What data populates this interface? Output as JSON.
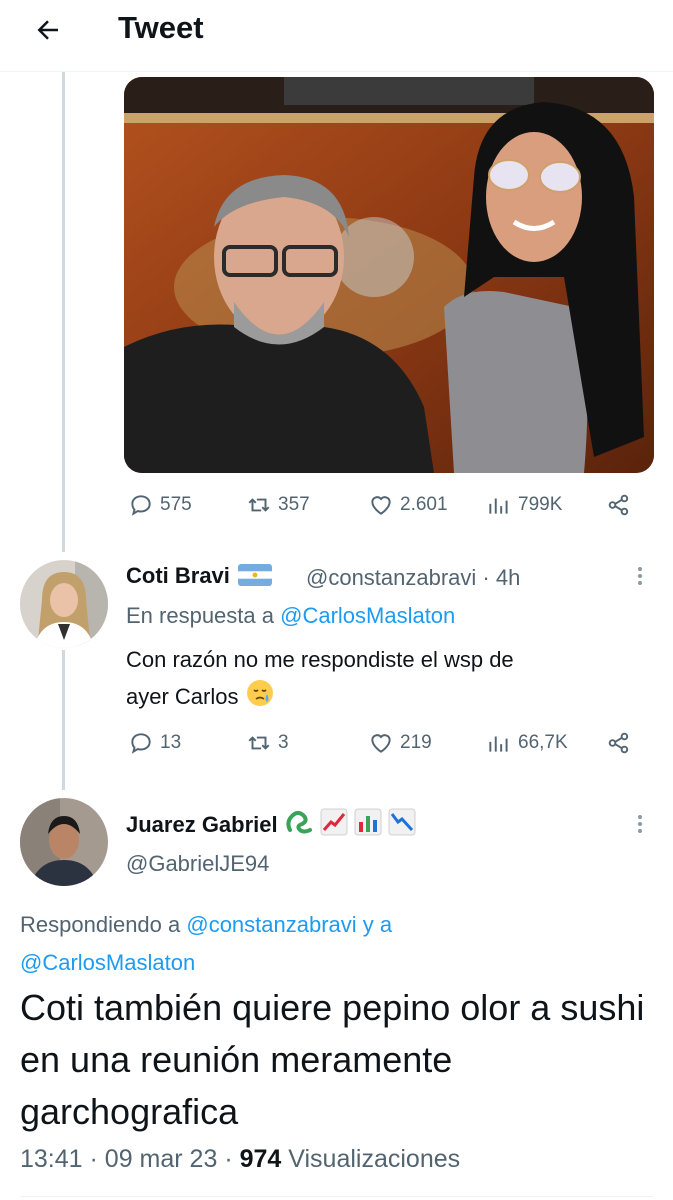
{
  "header": {
    "title": "Tweet"
  },
  "tweet1": {
    "stats": {
      "replies": "575",
      "retweets": "357",
      "likes": "2.601",
      "views": "799K"
    }
  },
  "tweet2": {
    "name": "Coti Bravi",
    "handle_time": "@constanzabravi · 4h",
    "reply_prefix": "En respuesta a ",
    "reply_to": "@CarlosMaslaton",
    "text_line1": "Con razón no me respondiste el wsp de",
    "text_line2": "ayer Carlos",
    "stats": {
      "replies": "13",
      "retweets": "3",
      "likes": "219",
      "views": "66,7K"
    }
  },
  "tweet3": {
    "name": "Juarez Gabriel",
    "handle": "@GabrielJE94",
    "reply_prefix": "Respondiendo a ",
    "reply_to_1": "@constanzabravi",
    "reply_join": " y a",
    "reply_to_2": "@CarlosMaslaton",
    "text": "Coti también quiere pepino olor a sushi en una reunión meramente garchografica",
    "time": "13:41",
    "date": "09 mar 23",
    "views_count": "974",
    "views_label": "Visualizaciones"
  },
  "colors": {
    "accent": "#1d9bf0",
    "secondary_text": "#536471",
    "primary_text": "#0f1419"
  }
}
